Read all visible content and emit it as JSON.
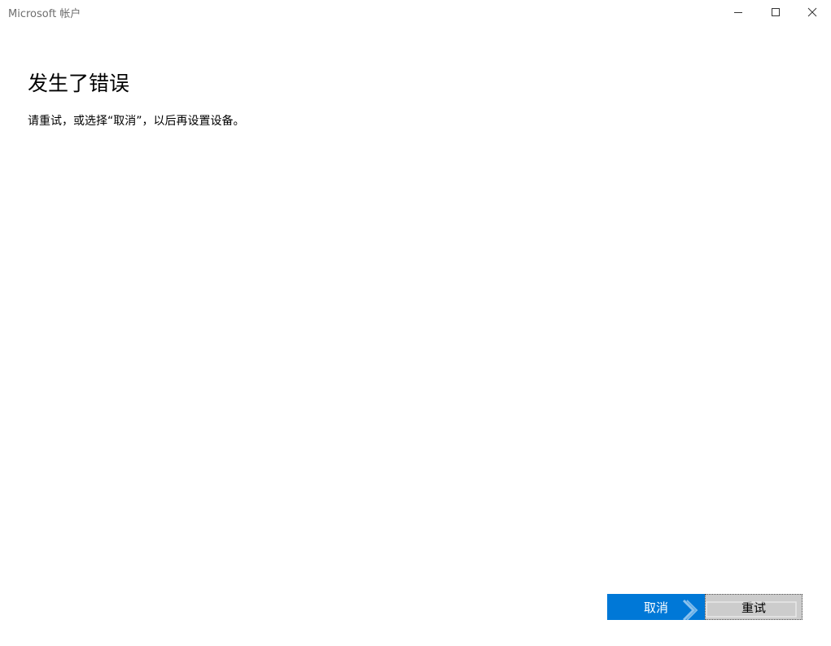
{
  "window": {
    "title": "Microsoft 帐户",
    "controls": {
      "minimize_icon": "minimize-icon",
      "maximize_icon": "maximize-icon",
      "close_icon": "close-icon"
    }
  },
  "main": {
    "heading": "发生了错误",
    "message": "请重试，或选择“取消”，以后再设置设备。"
  },
  "footer": {
    "cancel_label": "取消",
    "retry_label": "重试"
  },
  "colors": {
    "accent": "#0078d7",
    "secondary_button": "#cccccc",
    "title_text": "#6e6e6e"
  }
}
